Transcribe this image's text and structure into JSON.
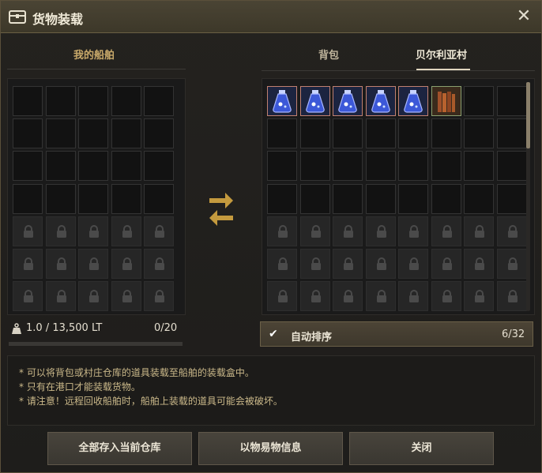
{
  "title": "货物装载",
  "left": {
    "header": "我的船舶",
    "weight": "1.0 / 13,500 LT",
    "slots_used": "0/20",
    "weight_fill": 0.0
  },
  "right": {
    "tabs": [
      "背包",
      "贝尔利亚村"
    ],
    "active_tab": "贝尔利亚村",
    "auto_sort_label": "自动排序",
    "auto_sort_checked": true,
    "count": "6/32",
    "items": [
      "blue-potion",
      "blue-potion",
      "blue-potion",
      "blue-potion",
      "blue-potion",
      "lumber-bundle"
    ]
  },
  "info": [
    "* 可以将背包或村庄仓库的道具装载至船舶的装载盒中。",
    "* 只有在港口才能装载货物。",
    "* 请注意！远程回收船舶时，船舶上装载的道具可能会被破坏。"
  ],
  "buttons": {
    "deposit_all": "全部存入当前仓库",
    "barter_info": "以物易物信息",
    "close": "关闭"
  },
  "colors": {
    "accent": "#c8a96a",
    "item_border": "#c08070"
  }
}
